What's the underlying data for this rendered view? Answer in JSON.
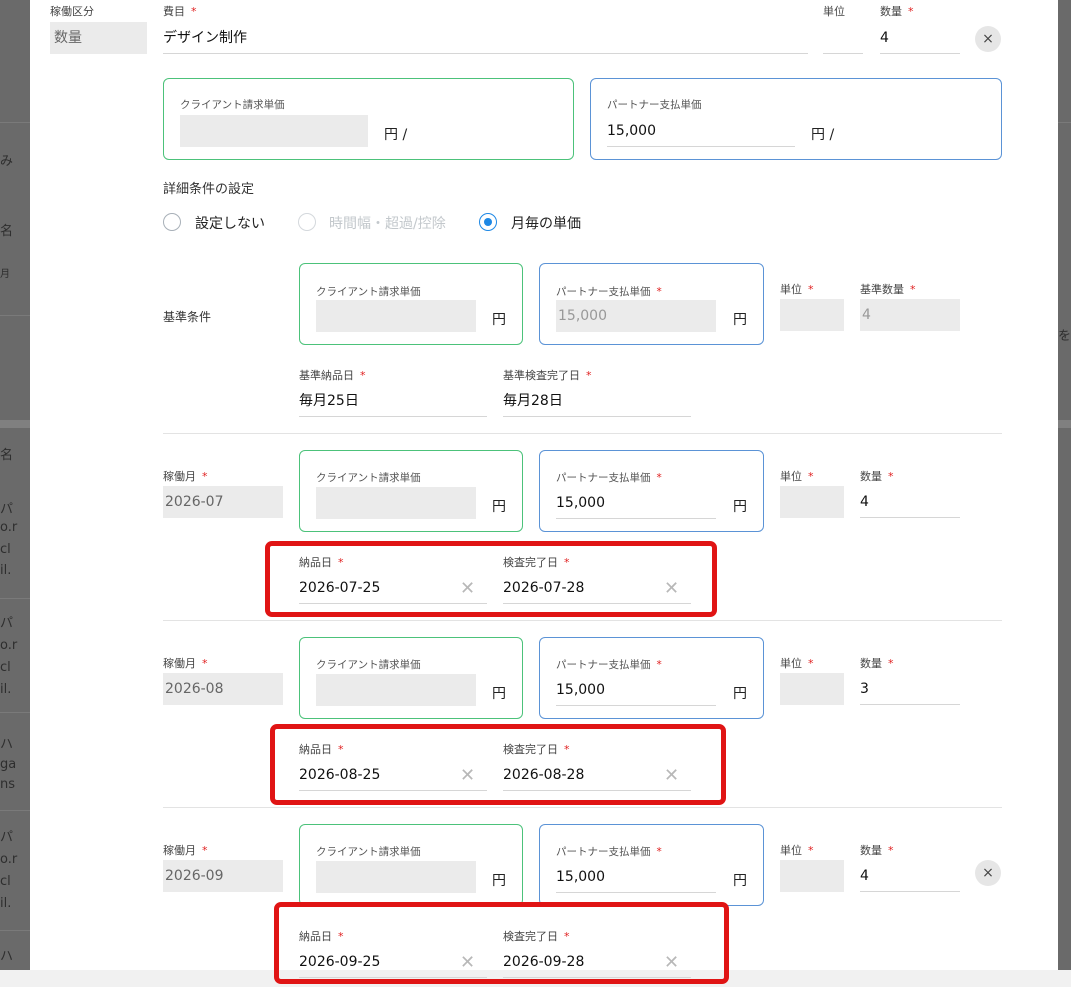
{
  "background": {
    "fragments": [
      "み",
      "名",
      "月",
      "名",
      "パ",
      "o.r",
      "cl",
      "il.",
      "パ",
      "o.r",
      "cl",
      "il.",
      "ハ",
      "ga",
      "ns",
      "パ",
      "o.r",
      "cl",
      "il.",
      "ハ"
    ],
    "right_fragment": "を"
  },
  "header_row": {
    "work_category_label": "稼働区分",
    "work_category_value": "数量",
    "expense_item_label": "費目",
    "expense_item_value": "デザイン制作",
    "unit_label": "単位",
    "unit_value": "",
    "quantity_label": "数量",
    "quantity_value": "4",
    "close_glyph": "×"
  },
  "unit_price": {
    "client_label": "クライアント請求単価",
    "client_suffix": "円 /",
    "partner_label": "パートナー支払単価",
    "partner_value": "15,000",
    "partner_suffix": "円 /"
  },
  "detail_conditions": {
    "title": "詳細条件の設定",
    "options": [
      "設定しない",
      "時間幅・超過/控除",
      "月毎の単価"
    ],
    "selected": "月毎の単価"
  },
  "base_condition": {
    "label": "基準条件",
    "client_label": "クライアント請求単価",
    "client_suffix": "円",
    "partner_label": "パートナー支払単価",
    "partner_value": "15,000",
    "partner_suffix": "円",
    "unit_label": "単位",
    "quantity_label": "基準数量",
    "quantity_value": "4",
    "delivery_label": "基準納品日",
    "delivery_value": "毎月25日",
    "inspection_label": "基準検査完了日",
    "inspection_value": "毎月28日"
  },
  "months": [
    {
      "month_label": "稼働月",
      "month_value": "2026-07",
      "client_label": "クライアント請求単価",
      "client_suffix": "円",
      "partner_label": "パートナー支払単価",
      "partner_value": "15,000",
      "partner_suffix": "円",
      "unit_label": "単位",
      "quantity_label": "数量",
      "quantity_value": "4",
      "delivery_label": "納品日",
      "delivery_value": "2026-07-25",
      "inspection_label": "検査完了日",
      "inspection_value": "2026-07-28"
    },
    {
      "month_label": "稼働月",
      "month_value": "2026-08",
      "client_label": "クライアント請求単価",
      "client_suffix": "円",
      "partner_label": "パートナー支払単価",
      "partner_value": "15,000",
      "partner_suffix": "円",
      "unit_label": "単位",
      "quantity_label": "数量",
      "quantity_value": "3",
      "delivery_label": "納品日",
      "delivery_value": "2026-08-25",
      "inspection_label": "検査完了日",
      "inspection_value": "2026-08-28"
    },
    {
      "month_label": "稼働月",
      "month_value": "2026-09",
      "client_label": "クライアント請求単価",
      "client_suffix": "円",
      "partner_label": "パートナー支払単価",
      "partner_value": "15,000",
      "partner_suffix": "円",
      "unit_label": "単位",
      "quantity_label": "数量",
      "quantity_value": "4",
      "delivery_label": "納品日",
      "delivery_value": "2026-09-25",
      "inspection_label": "検査完了日",
      "inspection_value": "2026-09-28"
    }
  ],
  "required_mark": "*",
  "clear_glyph": "✕",
  "colors": {
    "client_border": "#4cc27a",
    "partner_border": "#5b93d6",
    "radio_selected": "#1e88e5",
    "required": "#e02020",
    "highlight": "#e01414"
  }
}
